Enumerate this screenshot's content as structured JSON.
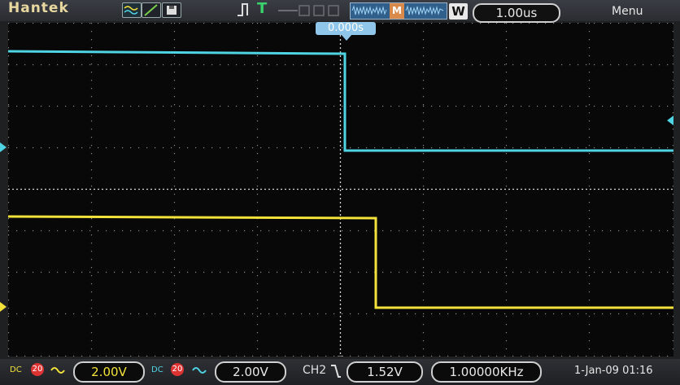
{
  "header": {
    "brand": "Hantek",
    "trigger_status": "T",
    "window_marker": "M",
    "window_label": "W",
    "timebase": "1.00us",
    "menu_label": "Menu",
    "trigger_position": "0.000s"
  },
  "footer": {
    "ch1_coupling": "DC",
    "ch1_bw": "20",
    "ch1_scale": "2.00V",
    "ch2_coupling": "DC",
    "ch2_bw": "20",
    "ch2_scale": "2.00V",
    "trigger_source": "CH2",
    "trigger_level": "1.52V",
    "frequency": "1.00000KHz",
    "date_time": "1-Jan-09 01:16"
  },
  "colors": {
    "ch1": "#f2e23a",
    "ch2": "#4fd4e4",
    "grid_dots": "#9a9a9a",
    "background": "#080808"
  }
}
